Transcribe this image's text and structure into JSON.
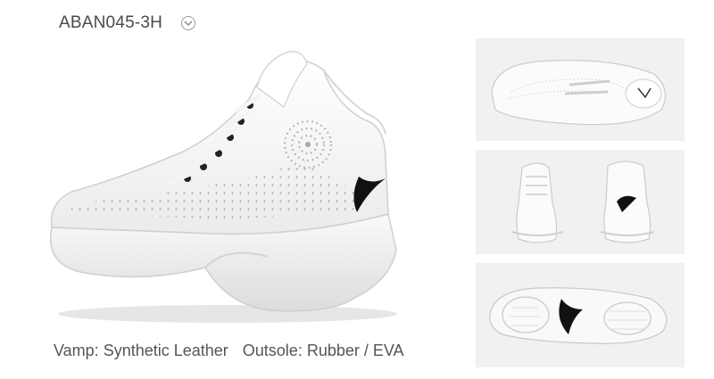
{
  "product": {
    "sku": "ABAN045-3H"
  },
  "specs": {
    "vamp": "Vamp: Synthetic Leather",
    "outsole": "Outsole: Rubber / EVA"
  },
  "icons": {
    "sku_toggle": "chevron-down-circle-icon"
  },
  "colors": {
    "shoe_body": "#f7f7f7",
    "shoe_shadow": "#d9d9d9",
    "accent_black": "#111111",
    "thumb_bg": "#f1f1f1"
  }
}
